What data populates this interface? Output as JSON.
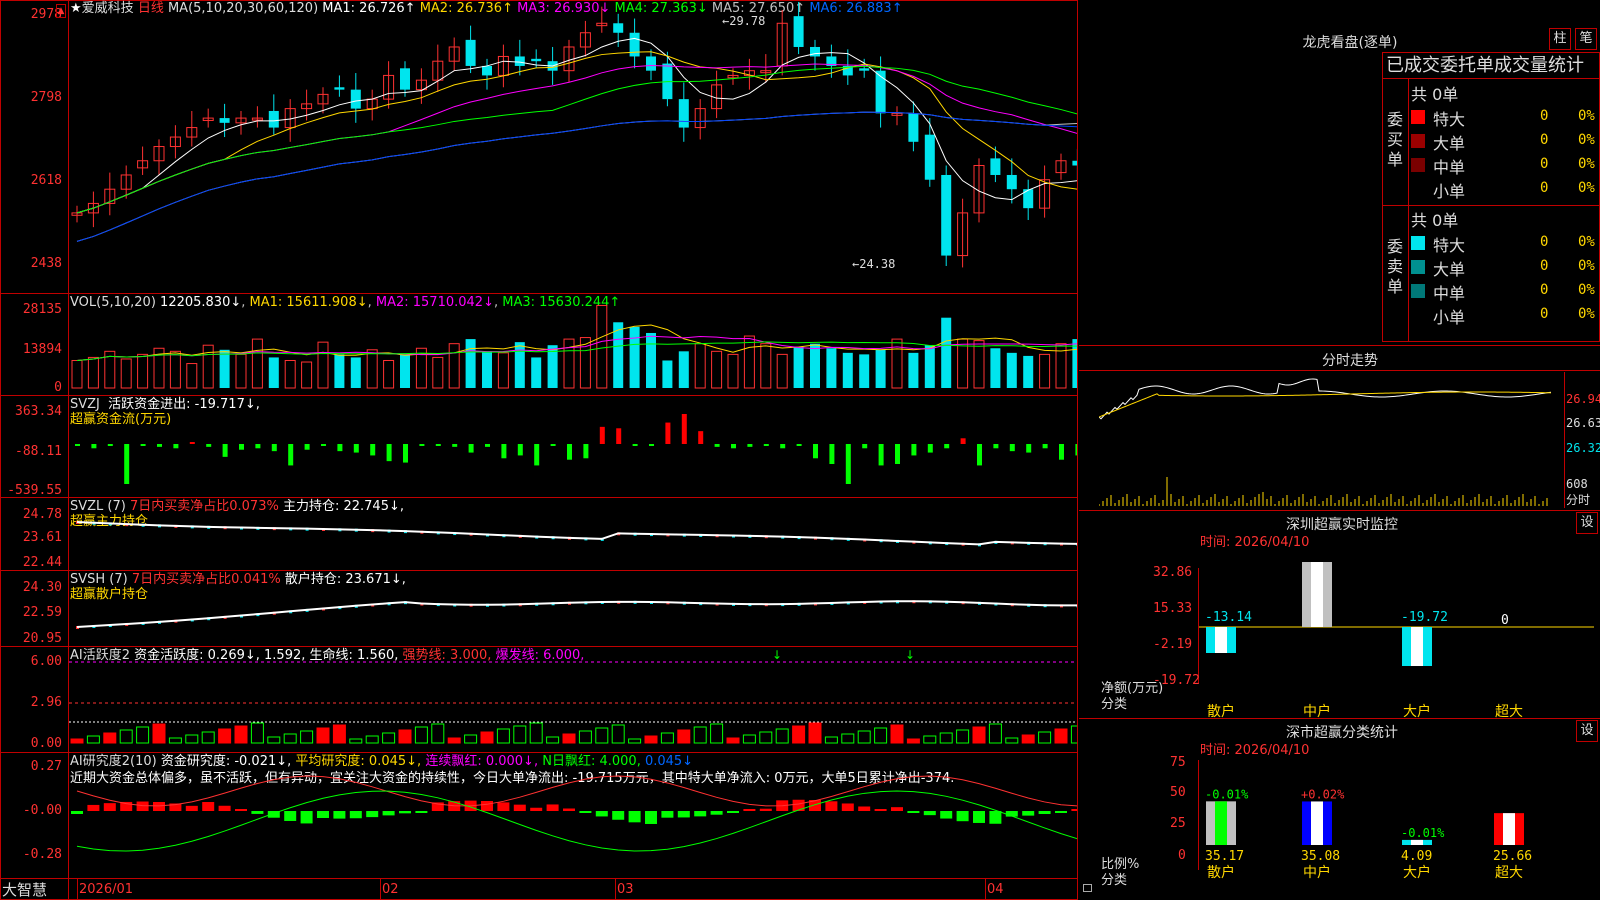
{
  "colors": {
    "up": "#ff3232",
    "down": "#00e5ee",
    "bg": "#000000",
    "frame": "#c00000",
    "ma1": "#ffffff",
    "ma2": "#ffd700",
    "ma3": "#ff00ff",
    "ma4": "#00ff00",
    "ma5": "#c0c0c0",
    "ma6": "#0044ff"
  },
  "main": {
    "star": "★",
    "name": "爱威科技",
    "period": "日线",
    "ma_header": "MA(5,10,20,30,60,120)",
    "ma_items": [
      {
        "label": "MA1: 26.726↑",
        "color": "#ffffff"
      },
      {
        "label": "MA2: 26.736↑",
        "color": "#ffd700"
      },
      {
        "label": "MA3: 26.930↓",
        "color": "#ff00ff"
      },
      {
        "label": "MA4: 27.363↓",
        "color": "#00ff00"
      },
      {
        "label": "MA5: 27.650↑",
        "color": "#c0c0c0"
      },
      {
        "label": "MA6: 26.883↑",
        "color": "#0066ff"
      }
    ],
    "high_label": "29.78",
    "low_label": "24.38",
    "yticks": [
      "2978",
      "2798",
      "2618",
      "2438"
    ]
  },
  "vol": {
    "header": "VOL(5,10,20)",
    "v": "12205.830↓",
    "ma1": "MA1: 15611.908↓",
    "ma2": "MA2: 15710.042↓",
    "ma3": "MA3: 15630.244↑",
    "yticks": [
      "28135",
      "13894",
      "0"
    ]
  },
  "svzj": {
    "header": "SVZJ",
    "line": "活跃资金进出: -19.717↓,",
    "sub": "超赢资金流(万元)",
    "yticks": [
      "363.34",
      "-88.11",
      "-539.55"
    ]
  },
  "svzl": {
    "header": "SVZL (7)",
    "red": "7日内买卖净占比0.073%",
    "line": "主力持仓: 22.745↓,",
    "sub": "超赢主力持仓",
    "yticks": [
      "24.78",
      "23.61",
      "22.44"
    ]
  },
  "svsh": {
    "header": "SVSH (7)",
    "red": "7日内买卖净占比0.041%",
    "line": "散户持仓: 23.671↓,",
    "sub": "超赢散户持仓",
    "yticks": [
      "24.30",
      "22.59",
      "20.95"
    ]
  },
  "ai1": {
    "header": "AI活跃度2",
    "a": "资金活跃度: 0.269↓, 1.592,",
    "b": "生命线: 1.560,",
    "c": "强势线: 3.000,",
    "d": "爆发线: 6.000,",
    "yticks": [
      "6.00",
      "2.96",
      "0.00"
    ]
  },
  "ai2": {
    "header": "AI研究度2(10)",
    "a": "资金研究度: -0.021↓,",
    "b": "平均研究度: 0.045↓,",
    "c": "连续飘红: 0.000↓,",
    "d": "N日飘红: 4.000,",
    "e": "0.045↓",
    "note": "近期大资金总体偏多，虽不活跃，但有异动，宜关注大资金的持续性，今日大单净流出: -19.715万元，其中特大单净流入: 0万元，大单5日累计净出-374.",
    "yticks": [
      "0.27",
      "-0.00",
      "-0.28"
    ]
  },
  "xaxis": {
    "labels": [
      "2026/01",
      "02",
      "03",
      "04"
    ]
  },
  "brand": "大智慧",
  "lhb": {
    "title": "龙虎看盘(逐单)",
    "btn1": "柱",
    "btn2": "笔",
    "header": "已成交委托单成交量统计",
    "buy": {
      "side": "委买单",
      "total": "共 0单",
      "rows": [
        {
          "label": "特大",
          "color": "#ff0000",
          "v": "0",
          "p": "0%"
        },
        {
          "label": "大单",
          "color": "#9b0000",
          "v": "0",
          "p": "0%"
        },
        {
          "label": "中单",
          "color": "#7a0000",
          "v": "0",
          "p": "0%"
        },
        {
          "label": "小单",
          "color": "",
          "v": "0",
          "p": "0%"
        }
      ]
    },
    "sell": {
      "side": "委卖单",
      "total": "共 0单",
      "rows": [
        {
          "label": "特大",
          "color": "#00e5ee",
          "v": "0",
          "p": "0%"
        },
        {
          "label": "大单",
          "color": "#009090",
          "v": "0",
          "p": "0%"
        },
        {
          "label": "中单",
          "color": "#007878",
          "v": "0",
          "p": "0%"
        },
        {
          "label": "小单",
          "color": "",
          "v": "0",
          "p": "0%"
        }
      ]
    }
  },
  "fs": {
    "title": "分时走势",
    "yticks": [
      "26.94",
      "26.63",
      "26.32"
    ],
    "vol": "608",
    "vol2": "分时"
  },
  "sz1": {
    "title": "深圳超赢实时监控",
    "btn": "设",
    "time": "时间: 2026/04/10",
    "ylabel": "净额(万元)",
    "xlabel": "分类",
    "yticks": [
      "32.86",
      "15.33",
      "-2.19",
      "-19.72"
    ],
    "cats": [
      "散户",
      "中户",
      "大户",
      "超大"
    ],
    "values": [
      -13.14,
      32.86,
      -19.72,
      0
    ],
    "labels": [
      "-13.14",
      "32.86",
      "-19.72",
      "0"
    ]
  },
  "sz2": {
    "title": "深市超赢分类统计",
    "btn": "设",
    "time": "时间: 2026/04/10",
    "ylabel": "比例%",
    "xlabel": "分类",
    "yticks": [
      "75",
      "50",
      "25",
      "0"
    ],
    "cats": [
      "散户",
      "中户",
      "大户",
      "超大"
    ],
    "values": [
      35.17,
      35.08,
      4.09,
      25.66
    ],
    "pct": [
      "-0.01%",
      "+0.02%",
      "-0.01%",
      ""
    ],
    "labels": [
      "35.17",
      "35.08",
      "4.09",
      "25.66"
    ]
  },
  "chart_data": {
    "type": "candlestick",
    "title": "爱威科技 日线",
    "x_ticks": [
      "2026/01",
      "02",
      "03",
      "04"
    ],
    "ylim": [
      24.38,
      29.78
    ],
    "high": 29.78,
    "low": 24.38,
    "close_ma": {
      "MA1": 26.726,
      "MA2": 26.736,
      "MA3": 26.93,
      "MA4": 27.363,
      "MA5": 27.65,
      "MA6": 26.883
    },
    "series": [
      {
        "name": "close",
        "values": [
          25.5,
          25.7,
          26.0,
          26.3,
          26.6,
          26.9,
          27.1,
          27.3,
          27.5,
          27.4,
          27.5,
          27.5,
          27.3,
          27.7,
          27.8,
          28.0,
          28.1,
          27.7,
          27.9,
          28.4,
          28.1,
          28.3,
          28.7,
          29.0,
          28.6,
          28.4,
          28.8,
          28.6,
          28.7,
          28.5,
          29.0,
          29.3,
          29.5,
          29.3,
          28.8,
          28.5,
          27.9,
          27.3,
          27.7,
          28.2,
          28.4,
          28.5,
          28.5,
          29.5,
          29.0,
          28.8,
          28.6,
          28.4,
          28.5,
          27.6,
          27.6,
          27.0,
          26.2,
          24.6,
          25.5,
          26.5,
          26.3,
          26.0,
          25.6,
          26.2,
          26.6,
          26.5,
          26.8,
          26.5,
          25.3,
          26.0,
          27.2,
          26.5,
          26.6
        ]
      },
      {
        "name": "volume",
        "values": [
          9000,
          10000,
          12000,
          9500,
          11000,
          13000,
          12000,
          8000,
          14000,
          12500,
          11000,
          16000,
          10000,
          9000,
          8500,
          15000,
          11000,
          10000,
          12500,
          9000,
          11000,
          13000,
          10000,
          14500,
          16000,
          12000,
          11500,
          15000,
          10000,
          14000,
          16000,
          16500,
          27000,
          21500,
          20000,
          18000,
          9000,
          12000,
          14500,
          12000,
          11000,
          17000,
          14500,
          11000,
          13500,
          14500,
          13000,
          11500,
          11000,
          12500,
          16000,
          11500,
          14000,
          23000,
          16000,
          15500,
          13000,
          11500,
          10500,
          11000,
          14500,
          16000,
          13500,
          14500,
          14500,
          11500,
          13000,
          12000,
          14000
        ]
      },
      {
        "name": "SVZJ",
        "values": [
          -10,
          -30,
          -10,
          -280,
          -10,
          -20,
          -30,
          0,
          -20,
          -90,
          -40,
          -30,
          -50,
          -150,
          -40,
          -10,
          -50,
          -60,
          -80,
          -120,
          -130,
          -10,
          -10,
          -20,
          -60,
          -20,
          -100,
          -80,
          -150,
          -10,
          -110,
          -100,
          120,
          110,
          -10,
          -10,
          150,
          210,
          90,
          -20,
          -30,
          -20,
          -10,
          -30,
          -10,
          -100,
          -140,
          -280,
          -30,
          -150,
          -140,
          -80,
          -60,
          -30,
          40,
          -150,
          -30,
          -50,
          -60,
          -30,
          -110,
          -80,
          -20,
          -30,
          -90,
          -20,
          -50,
          -40,
          120,
          -20,
          -10,
          -110,
          -20,
          -10,
          -140,
          -30,
          -60,
          -60,
          100,
          -20,
          -10,
          20,
          -20,
          -30,
          -10,
          -10,
          -20,
          -140,
          -180,
          -50,
          20,
          -40,
          -20,
          -20,
          110,
          -50,
          -20,
          20,
          -10,
          70,
          -10,
          -20,
          -10
        ]
      }
    ]
  }
}
